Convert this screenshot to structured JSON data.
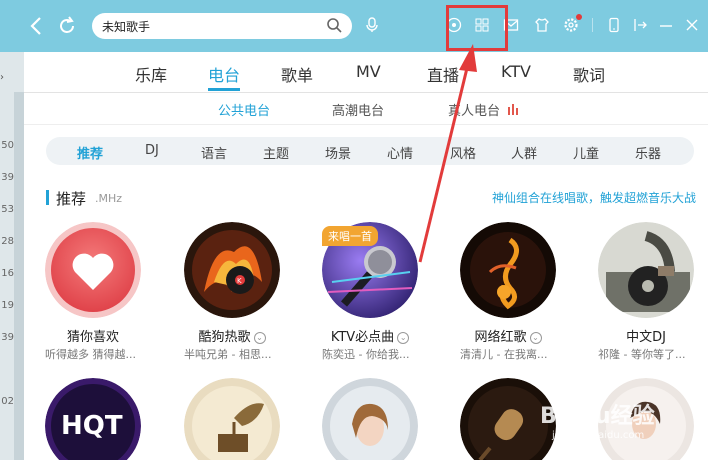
{
  "topbar": {
    "search_value": "未知歌手",
    "icons": [
      "back-icon",
      "refresh-icon",
      "search-icon",
      "mic-icon",
      "play-circle-icon",
      "grid-icon",
      "mail-icon",
      "shirt-icon",
      "gear-icon",
      "phone-icon",
      "exit-icon",
      "minimize-icon",
      "close-icon"
    ],
    "accent": "#7ecbe0"
  },
  "left_numbers": [
    "50",
    "39",
    "53",
    "28",
    "16",
    "19",
    "39",
    "02"
  ],
  "nav": {
    "items": [
      "乐库",
      "电台",
      "歌单",
      "MV",
      "直播",
      "KTV",
      "歌词"
    ],
    "active": "电台"
  },
  "subnav": {
    "items": [
      "公共电台",
      "高潮电台",
      "真人电台"
    ],
    "active": "公共电台"
  },
  "categories": {
    "items": [
      "推荐",
      "DJ",
      "语言",
      "主题",
      "场景",
      "心情",
      "风格",
      "人群",
      "儿童",
      "乐器"
    ],
    "active": "推荐"
  },
  "section": {
    "title": "推荐",
    "subtitle": ".MHz",
    "promo": "神仙组合在线唱歌，触发超燃音乐大战"
  },
  "cards": [
    {
      "title": "猜你喜欢",
      "desc": "听得越多 猜得越...",
      "dropdown": false
    },
    {
      "title": "酷狗热歌",
      "desc": "半吨兄弟 - 相思...",
      "dropdown": true
    },
    {
      "title": "KTV必点曲",
      "desc": "陈奕迅 - 你给我...",
      "dropdown": true,
      "tag": "来唱一首"
    },
    {
      "title": "网络红歌",
      "desc": "清清儿 - 在我离...",
      "dropdown": true
    },
    {
      "title": "中文DJ",
      "desc": "祁隆 - 等你等了...",
      "dropdown": false
    }
  ],
  "bottom_row": {
    "hqt_text": "HQT"
  },
  "watermark": {
    "main": "Baidu经验",
    "sub": "jingyan.baidu.com"
  },
  "colors": {
    "accent": "#22a2d6",
    "highlight": "#e23b3b",
    "tag": "#f2a531"
  }
}
